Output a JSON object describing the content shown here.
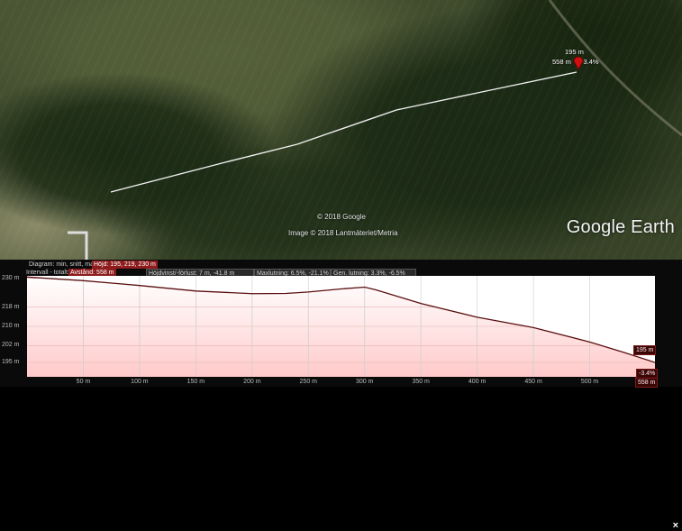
{
  "map": {
    "copyright": "© 2018 Google",
    "imagery": "Image © 2018 Lantmäteriet/Metria",
    "logo": "Google Earth",
    "pin": {
      "elevation": "195 m",
      "distance": "558 m",
      "slope": "-3.4%",
      "icon": "map-pin-icon"
    }
  },
  "panel": {
    "close": "×",
    "row1": {
      "label": "Diagram: min, snitt, max",
      "value": "Höjd: 195, 219, 230 m"
    },
    "row2": {
      "label": "Intervall - totalt:",
      "distance": "Avstånd: 558 m",
      "elevation_change": "Höjdvinst/-förlust: 7 m, -41.8 m",
      "max_slope": "Maxlutning: 6.5%, -21.1%",
      "avg_slope": "Gen. lutning: 3.3%, -6.5%"
    },
    "end_labels": {
      "elevation": "195 m",
      "slope": "-3.4%",
      "distance": "558 m"
    }
  },
  "chart_data": {
    "type": "area",
    "x_unit": "m",
    "y_unit": "m",
    "x_ticks": [
      "50 m",
      "100 m",
      "150 m",
      "200 m",
      "250 m",
      "300 m",
      "350 m",
      "400 m",
      "450 m",
      "500 m"
    ],
    "y_ticks": [
      "230 m",
      "218 m",
      "210 m",
      "202 m",
      "195 m"
    ],
    "xlim": [
      0,
      558
    ],
    "ylim": [
      189,
      231
    ],
    "x": [
      0,
      50,
      100,
      150,
      200,
      230,
      250,
      280,
      300,
      310,
      350,
      400,
      450,
      500,
      530,
      558
    ],
    "y": [
      230.5,
      229,
      227,
      224.7,
      223.6,
      223.7,
      224.3,
      225.6,
      226.3,
      225.2,
      219.5,
      213.8,
      209.5,
      203.5,
      199.2,
      195
    ],
    "fill_color": "#ffc9c9",
    "line_color": "#5a0f0f",
    "grid": true
  }
}
